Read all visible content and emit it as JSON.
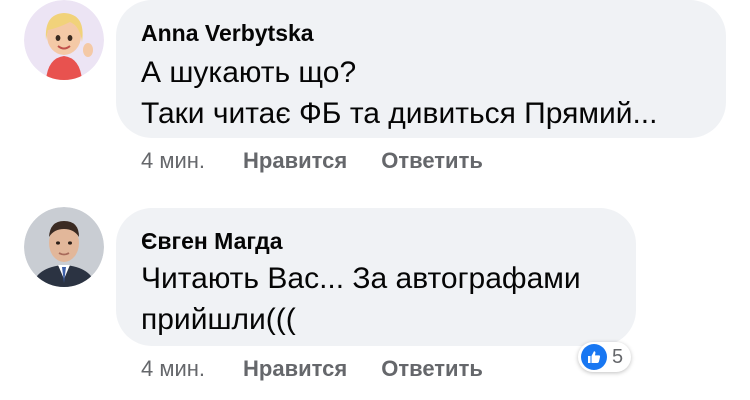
{
  "comments": [
    {
      "author": "Anna Verbytska",
      "lines": [
        "А шукають що?",
        "Таки читає ФБ та дивиться Прямий..."
      ],
      "time": "4 мин.",
      "like_label": "Нравится",
      "reply_label": "Ответить"
    },
    {
      "author": "Євген Магда",
      "lines": [
        "Читають Вас... За автографами",
        "прийшли((("
      ],
      "time": "4 мин.",
      "like_label": "Нравится",
      "reply_label": "Ответить",
      "reaction_count": "5",
      "reaction_icon": "like-icon"
    }
  ],
  "colors": {
    "bubble": "#f0f2f5",
    "text": "#050505",
    "meta": "#65676b",
    "like_blue": "#1877f2"
  }
}
